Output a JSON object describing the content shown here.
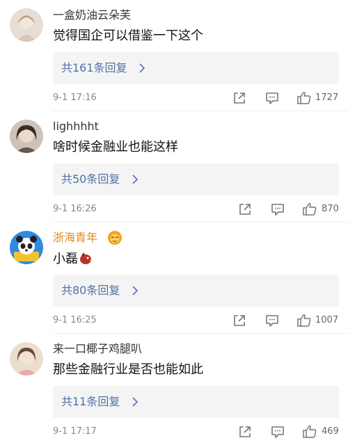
{
  "comments": [
    {
      "username": "一盒奶油云朵芙",
      "text": "觉得国企可以借鉴一下这个",
      "reply_label": "共161条回复",
      "timestamp": "9-1 17:16",
      "likes": "1727"
    },
    {
      "username": "lighhhht",
      "text": "啥时候金融业也能这样",
      "reply_label": "共50条回复",
      "timestamp": "9-1 16:26",
      "likes": "870"
    },
    {
      "username": "浙海青年",
      "text": "小磊",
      "reply_label": "共80条回复",
      "timestamp": "9-1 16:25",
      "likes": "1007"
    },
    {
      "username": "来一口椰子鸡腿叭",
      "text": "那些金融行业是否也能如此",
      "reply_label": "共11条回复",
      "timestamp": "9-1 17:17",
      "likes": "469"
    }
  ],
  "icons": {
    "reply_arrow": "chevron-right-icon",
    "share": "share-icon",
    "comment": "comment-icon",
    "like": "thumbs-up-icon",
    "badge": "lion-emoji-badge-icon",
    "text_emoji": "bird-emoji-icon"
  },
  "colors": {
    "link": "#4f72a6",
    "highlight_username": "#e08a1e",
    "reply_background": "#f4f4f4"
  }
}
